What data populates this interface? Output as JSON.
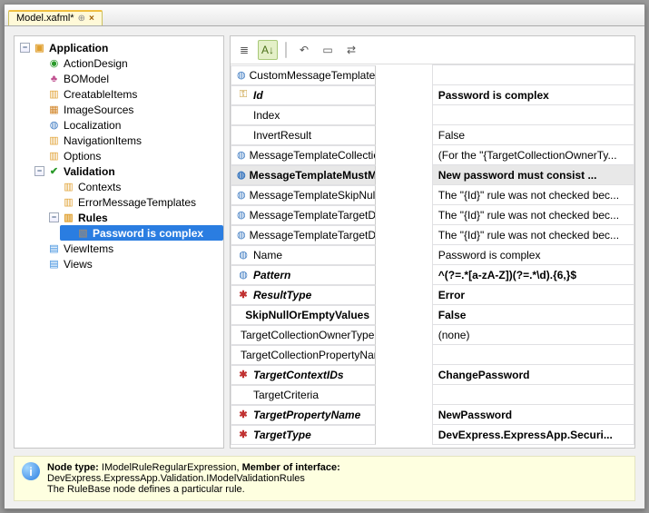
{
  "tab": {
    "title": "Model.xafml*",
    "close_glyph": "×"
  },
  "tree": {
    "root": {
      "label": "Application"
    },
    "items": [
      {
        "label": "ActionDesign",
        "icon": "action"
      },
      {
        "label": "BOModel",
        "icon": "bomodel"
      },
      {
        "label": "CreatableItems",
        "icon": "folder"
      },
      {
        "label": "ImageSources",
        "icon": "image"
      },
      {
        "label": "Localization",
        "icon": "globe"
      },
      {
        "label": "NavigationItems",
        "icon": "folder"
      },
      {
        "label": "Options",
        "icon": "folder"
      },
      {
        "label": "Validation",
        "icon": "check",
        "expanded": true,
        "bold": true,
        "children": [
          {
            "label": "Contexts",
            "icon": "folder"
          },
          {
            "label": "ErrorMessageTemplates",
            "icon": "folder"
          },
          {
            "label": "Rules",
            "icon": "folder",
            "bold": true,
            "expanded": true,
            "children": [
              {
                "label": "Password is complex",
                "icon": "rule",
                "selected": true,
                "bold": true
              }
            ]
          }
        ]
      },
      {
        "label": "ViewItems",
        "icon": "views"
      },
      {
        "label": "Views",
        "icon": "views"
      }
    ]
  },
  "toolbar": {
    "categorize": "≣",
    "alpha": "A↓",
    "undo": "↶",
    "props": "▭",
    "link": "⇄"
  },
  "props": [
    {
      "icon": "globe",
      "name": "CustomMessageTemplate",
      "value": "",
      "style": ""
    },
    {
      "icon": "key",
      "name": "Id",
      "value": "Password is complex",
      "style": "bold"
    },
    {
      "icon": "",
      "name": "Index",
      "value": "",
      "style": ""
    },
    {
      "icon": "",
      "name": "InvertResult",
      "value": "False",
      "style": ""
    },
    {
      "icon": "globe",
      "name": "MessageTemplateCollectionValidation",
      "value": "(For the \"{TargetCollectionOwnerTy...",
      "style": ""
    },
    {
      "icon": "globe",
      "name": "MessageTemplateMustMatchPattern",
      "value": "New password must consist ...",
      "style": "boldnorm",
      "selected": true
    },
    {
      "icon": "globe",
      "name": "MessageTemplateSkipNullOrEmptyValues",
      "value": "The \"{Id}\" rule was not checked bec...",
      "style": ""
    },
    {
      "icon": "globe",
      "name": "MessageTemplateTargetDoesNotSatisfyCollectionCriteria",
      "value": "The \"{Id}\" rule was not checked bec...",
      "style": ""
    },
    {
      "icon": "globe",
      "name": "MessageTemplateTargetDoesNotSatisfyTargetCriteria",
      "value": "The \"{Id}\" rule was not checked bec...",
      "style": ""
    },
    {
      "icon": "globe",
      "name": "Name",
      "value": "Password is complex",
      "style": ""
    },
    {
      "icon": "globe",
      "name": "Pattern",
      "value": "^(?=.*[a-zA-Z])(?=.*\\d).{6,}$",
      "style": "bold"
    },
    {
      "icon": "ast",
      "name": "ResultType",
      "value": "Error",
      "style": "bold"
    },
    {
      "icon": "",
      "name": "SkipNullOrEmptyValues",
      "value": "False",
      "style": "boldnorm"
    },
    {
      "icon": "",
      "name": "TargetCollectionOwnerType",
      "value": "(none)",
      "style": ""
    },
    {
      "icon": "",
      "name": "TargetCollectionPropertyName",
      "value": "",
      "style": ""
    },
    {
      "icon": "ast",
      "name": "TargetContextIDs",
      "value": "ChangePassword",
      "style": "bold"
    },
    {
      "icon": "",
      "name": "TargetCriteria",
      "value": "",
      "style": ""
    },
    {
      "icon": "ast",
      "name": "TargetPropertyName",
      "value": "NewPassword",
      "style": "bold"
    },
    {
      "icon": "ast",
      "name": "TargetType",
      "value": "DevExpress.ExpressApp.Securi...",
      "style": "bold"
    }
  ],
  "footer": {
    "line1a": "Node type: ",
    "line1b": "IModelRuleRegularExpression",
    "line1c": ", ",
    "line1d": "Member of interface:",
    "line2": "DevExpress.ExpressApp.Validation.IModelValidationRules",
    "line3": "The RuleBase node defines a particular rule."
  }
}
